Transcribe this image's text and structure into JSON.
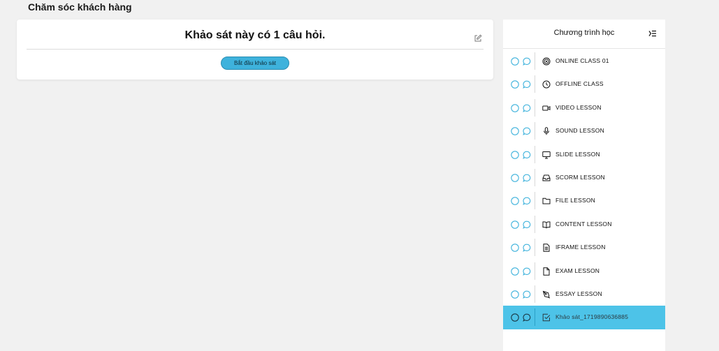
{
  "page": {
    "title": "Chăm sóc khách hàng"
  },
  "survey": {
    "heading": "Khảo sát này có 1 câu hỏi.",
    "start_button_label": "Bắt đầu khảo sát",
    "edit_icon": "edit-icon"
  },
  "curriculum": {
    "title": "Chương trình học",
    "collapse_icon": "collapse-menu-icon",
    "active_color": "#4dc3e8",
    "status_color": "#3eb2dc",
    "items": [
      {
        "label": "ONLINE CLASS 01",
        "icon": "target-icon"
      },
      {
        "label": "OFFLINE CLASS",
        "icon": "clock-icon"
      },
      {
        "label": "VIDEO LESSON",
        "icon": "video-icon"
      },
      {
        "label": "SOUND LESSON",
        "icon": "microphone-icon"
      },
      {
        "label": "SLIDE LESSON",
        "icon": "monitor-icon"
      },
      {
        "label": "SCORM LESSON",
        "icon": "inbox-icon"
      },
      {
        "label": "FILE LESSON",
        "icon": "folder-icon"
      },
      {
        "label": "CONTENT LESSON",
        "icon": "book-icon"
      },
      {
        "label": "IFRAME LESSON",
        "icon": "document-text-icon"
      },
      {
        "label": "EXAM LESSON",
        "icon": "file-icon"
      },
      {
        "label": "ESSAY LESSON",
        "icon": "pen-tool-icon"
      },
      {
        "label": "Khảo sát_1719890636885",
        "icon": "checkbox-icon",
        "active": true
      }
    ]
  }
}
